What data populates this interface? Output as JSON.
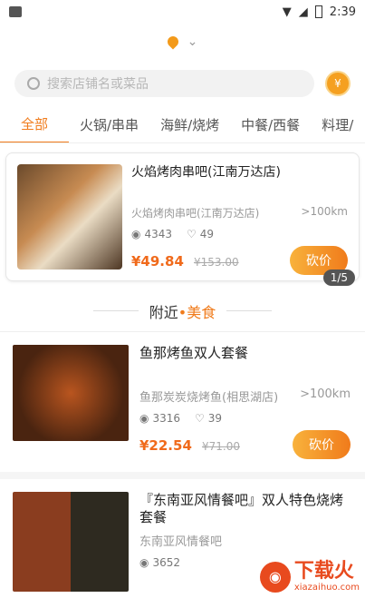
{
  "status": {
    "time": "2:39"
  },
  "search": {
    "placeholder": "搜索店铺名或菜品"
  },
  "tabs": [
    "全部",
    "火锅/串串",
    "海鲜/烧烤",
    "中餐/西餐",
    "料理/"
  ],
  "featured": {
    "title": "火焰烤肉串吧(江南万达店)",
    "shop": "火焰烤肉串吧(江南万达店)",
    "distance": ">100km",
    "views": "4343",
    "likes": "49",
    "price": "¥49.84",
    "old_price": "¥153.00",
    "btn": "砍价",
    "pager": "1/5"
  },
  "section": {
    "prefix": "附近",
    "dot": "•",
    "highlight": "美食"
  },
  "items": [
    {
      "title": "鱼那烤鱼双人套餐",
      "shop": "鱼那炭炭烧烤鱼(相思湖店)",
      "distance": ">100km",
      "views": "3316",
      "likes": "39",
      "price": "¥22.54",
      "old_price": "¥71.00",
      "btn": "砍价"
    },
    {
      "title": "『东南亚风情餐吧』双人特色烧烤套餐",
      "shop": "东南亚风情餐吧",
      "views": "3652"
    }
  ],
  "watermark": {
    "cn": "下载火",
    "en": "xiazaihuo.com"
  }
}
